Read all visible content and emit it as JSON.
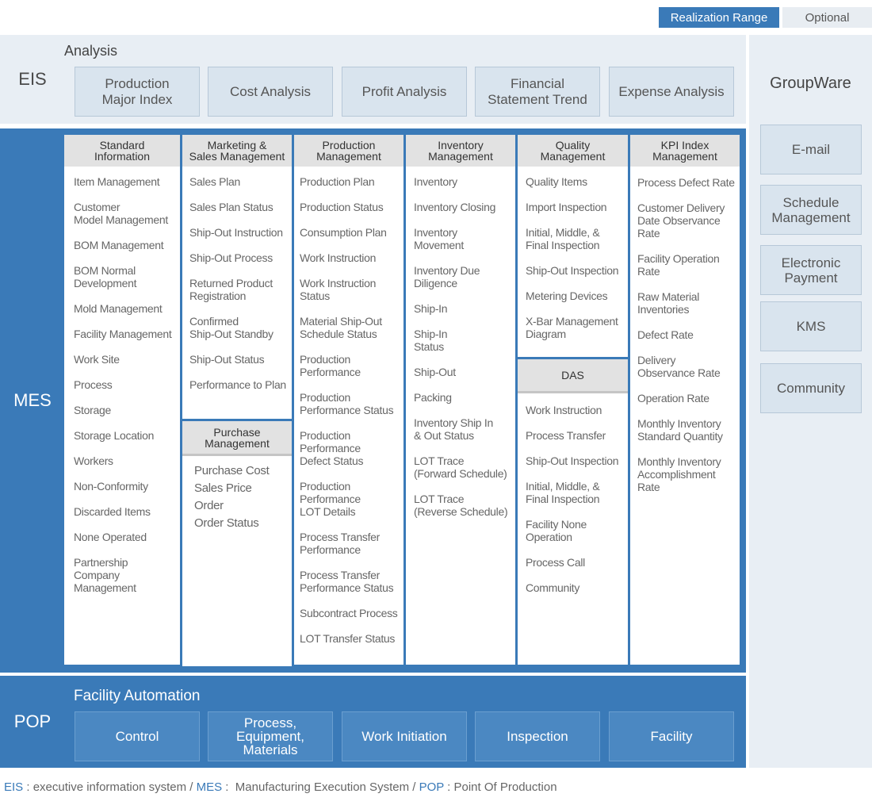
{
  "legend": {
    "realization": "Realization Range",
    "optional": "Optional"
  },
  "eis": {
    "label": "EIS",
    "subtitle": "Analysis",
    "boxes": [
      "Production\nMajor Index",
      "Cost Analysis",
      "Profit Analysis",
      "Financial\nStatement Trend",
      "Expense Analysis"
    ]
  },
  "mes": {
    "label": "MES",
    "columns": [
      {
        "title": "Standard\nInformation",
        "items": [
          "Item Management",
          "Customer\nModel Management",
          "BOM Management",
          "BOM Normal\nDevelopment",
          "Mold Management",
          "Facility Management",
          "Work Site",
          "Process",
          "Storage",
          "Storage Location",
          "Workers",
          "Non-Conformity",
          "Discarded Items",
          "None Operated",
          "Partnership\nCompany\nManagement"
        ]
      },
      {
        "title": "Marketing &\nSales Management",
        "items": [
          "Sales Plan",
          "Sales Plan Status",
          "Ship-Out Instruction",
          "Ship-Out Process",
          "Returned Product\nRegistration",
          "Confirmed\nShip-Out Standby",
          "Ship-Out Status",
          "Performance to Plan"
        ],
        "sub_title": "Purchase\nManagement",
        "sub_items": [
          "Purchase Cost",
          "Sales Price",
          "Order",
          "Order Status"
        ]
      },
      {
        "title": "Production\nManagement",
        "items": [
          "Production Plan",
          "Production Status",
          "Consumption Plan",
          "Work Instruction",
          "Work Instruction\nStatus",
          "Material Ship-Out\nSchedule Status",
          "Production\nPerformance",
          "Production\nPerformance Status",
          "Production\nPerformance\nDefect Status",
          "Production\nPerformance\nLOT Details",
          "Process Transfer\nPerformance",
          "Process Transfer\nPerformance Status",
          "Subcontract Process",
          "LOT Transfer Status"
        ]
      },
      {
        "title": "Inventory\nManagement",
        "items": [
          "Inventory",
          "Inventory Closing",
          "Inventory\nMovement",
          "Inventory Due\nDiligence",
          "Ship-In",
          "Ship-In\nStatus",
          "Ship-Out",
          "Packing",
          "Inventory Ship In\n& Out Status",
          "LOT Trace\n(Forward Schedule)",
          "LOT Trace\n(Reverse Schedule)"
        ]
      },
      {
        "title": "Quality\nManagement",
        "items": [
          "Quality Items",
          "Import Inspection",
          "Initial, Middle, &\nFinal Inspection",
          "Ship-Out Inspection",
          "Metering Devices",
          "X-Bar Management\nDiagram"
        ],
        "sub_title": "DAS",
        "sub_items": [
          "Work Instruction",
          "Process Transfer",
          "Ship-Out Inspection",
          "Initial, Middle, &\nFinal Inspection",
          "Facility None\nOperation",
          "Process Call",
          "Community"
        ]
      },
      {
        "title": "KPI Index\nManagement",
        "items": [
          "Process Defect Rate",
          "Customer Delivery\nDate Observance\nRate",
          "Facility Operation\nRate",
          "Raw Material\nInventories",
          "Defect Rate",
          "Delivery\nObservance Rate",
          "Operation Rate",
          "Monthly Inventory\nStandard Quantity",
          "Monthly Inventory\nAccomplishment\nRate"
        ]
      }
    ]
  },
  "pop": {
    "label": "POP",
    "subtitle": "Facility Automation",
    "boxes": [
      "Control",
      "Process,\nEquipment,\nMaterials",
      "Work Initiation",
      "Inspection",
      "Facility"
    ]
  },
  "groupware": {
    "title": "GroupWare",
    "items": [
      "E-mail",
      "Schedule\nManagement",
      "Electronic\nPayment",
      "KMS",
      "Community"
    ]
  },
  "footer": {
    "eis_key": "EIS",
    "eis_text": " : executive information system / ",
    "mes_key": "MES",
    "mes_text": " :  Manufacturing Execution System / ",
    "pop_key": "POP",
    "pop_text": " : Point Of Production"
  },
  "colors": {
    "accent": "#3a7ab8",
    "light_band": "#e8eef4",
    "box_fill": "#d9e4ee",
    "header_fill": "#e2e2e2"
  }
}
